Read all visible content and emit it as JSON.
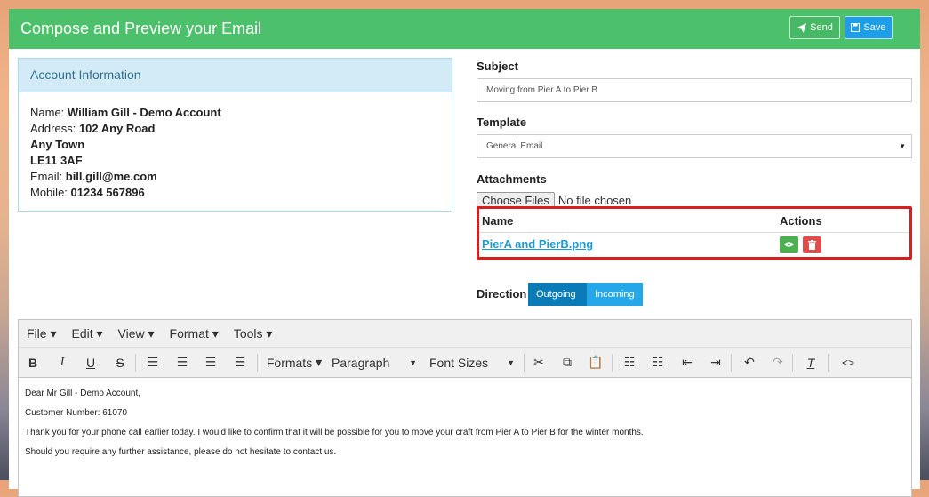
{
  "header": {
    "title": "Compose and Preview your Email",
    "send_label": "Send",
    "save_label": "Save"
  },
  "account": {
    "title": "Account Information",
    "name_label": "Name:",
    "name": "William Gill - Demo Account",
    "address_label": "Address:",
    "address1": "102 Any Road",
    "address2": "Any Town",
    "postcode": "LE11 3AF",
    "email_label": "Email:",
    "email": "bill.gill@me.com",
    "mobile_label": "Mobile:",
    "mobile": "01234 567896"
  },
  "subject": {
    "label": "Subject",
    "value": "Moving from Pier A to Pier B"
  },
  "template": {
    "label": "Template",
    "value": "General Email"
  },
  "attachments": {
    "label": "Attachments",
    "choose_label": "Choose Files",
    "no_file": "No file chosen",
    "col_name": "Name",
    "col_actions": "Actions",
    "files": [
      {
        "name": "PierA and PierB.png"
      }
    ]
  },
  "direction": {
    "label": "Direction",
    "options": [
      "Outgoing",
      "Incoming"
    ],
    "selected": "Outgoing"
  },
  "editor": {
    "menu": [
      "File",
      "Edit",
      "View",
      "Format",
      "Tools"
    ],
    "formats_label": "Formats",
    "paragraph_label": "Paragraph",
    "font_sizes_label": "Font Sizes",
    "body": [
      "Dear Mr Gill - Demo Account,",
      "Customer Number: 61070",
      "Thank you for your phone call earlier today.  I would like to confirm that it will be possible for you to move your craft from Pier A to Pier B for the winter months.",
      "Should you require any further assistance, please do not hesitate to contact us."
    ]
  }
}
